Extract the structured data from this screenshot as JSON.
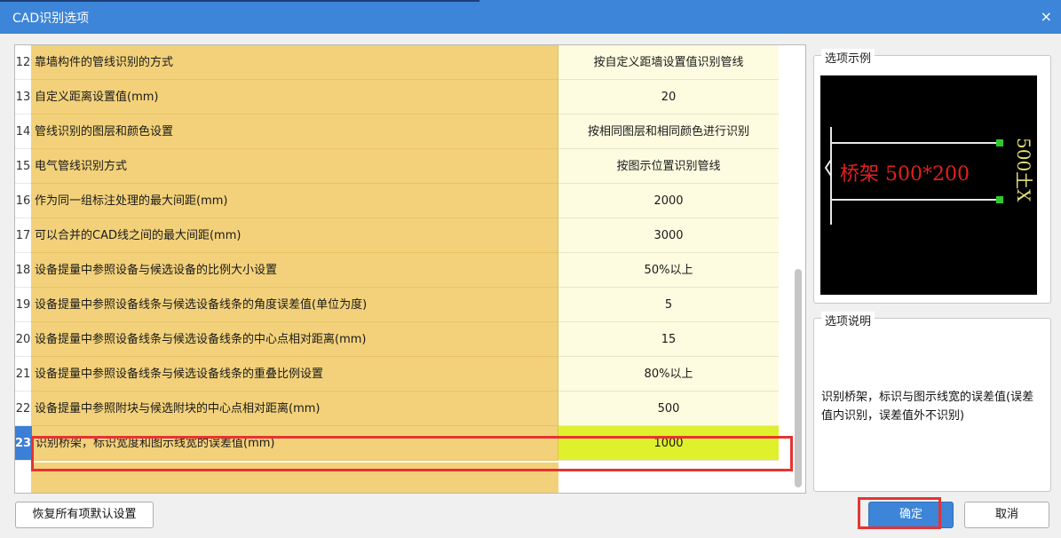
{
  "window": {
    "title": "CAD识别选项",
    "close_glyph": "×"
  },
  "rows": [
    {
      "num": "12",
      "label": "靠墙构件的管线识别的方式",
      "value": "按自定义距墙设置值识别管线"
    },
    {
      "num": "13",
      "label": "自定义距离设置值(mm)",
      "value": "20"
    },
    {
      "num": "14",
      "label": "管线识别的图层和颜色设置",
      "value": "按相同图层和相同颜色进行识别"
    },
    {
      "num": "15",
      "label": "电气管线识别方式",
      "value": "按图示位置识别管线"
    },
    {
      "num": "16",
      "label": "作为同一组标注处理的最大间距(mm)",
      "value": "2000"
    },
    {
      "num": "17",
      "label": "可以合并的CAD线之间的最大间距(mm)",
      "value": "3000"
    },
    {
      "num": "18",
      "label": "设备提量中参照设备与候选设备的比例大小设置",
      "value": "50%以上"
    },
    {
      "num": "19",
      "label": "设备提量中参照设备线条与候选设备线条的角度误差值(单位为度)",
      "value": "5"
    },
    {
      "num": "20",
      "label": "设备提量中参照设备线条与候选设备线条的中心点相对距离(mm)",
      "value": "15"
    },
    {
      "num": "21",
      "label": "设备提量中参照设备线条与候选设备线条的重叠比例设置",
      "value": "80%以上"
    },
    {
      "num": "22",
      "label": "设备提量中参照附块与候选附块的中心点相对距离(mm)",
      "value": "500"
    },
    {
      "num": "23",
      "label": "识别桥架，标识宽度和图示线宽的误差值(mm)",
      "value": "1000"
    }
  ],
  "example": {
    "title": "选项示例",
    "tray_label": "桥架 500*200",
    "side_label": "500土X"
  },
  "description": {
    "title": "选项说明",
    "text": "识别桥架，标识与图示线宽的误差值(误差值内识别，误差值外不识别)"
  },
  "buttons": {
    "reset": "恢复所有项默认设置",
    "ok": "确定",
    "cancel": "取消"
  },
  "colors": {
    "title_bar": "#3d85d8",
    "name_cell": "#f2d17a",
    "value_cell": "#fdfce0",
    "selected_value": "#dff02c",
    "highlight_box": "#e53333"
  }
}
